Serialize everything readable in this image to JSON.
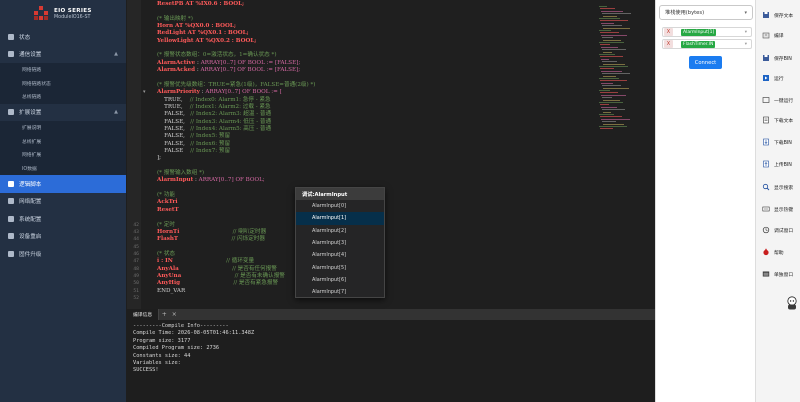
{
  "sidebar": {
    "brand_title": "EIO SERIES",
    "brand_subtitle": "ModuleIO16-ST",
    "items": [
      {
        "label": "状态",
        "type": "item",
        "icon": "status-icon"
      },
      {
        "label": "通信设置",
        "type": "item",
        "icon": "network-icon",
        "arrow": "▲"
      },
      {
        "label": "网络链路",
        "type": "sub"
      },
      {
        "label": "网络链路状态",
        "type": "sub"
      },
      {
        "label": "总线链路",
        "type": "sub"
      },
      {
        "label": "扩展设置",
        "type": "item",
        "icon": "expand-icon",
        "arrow": "▲"
      },
      {
        "label": "扩展说明",
        "type": "sub"
      },
      {
        "label": "总线扩展",
        "type": "sub"
      },
      {
        "label": "网络扩展",
        "type": "sub"
      },
      {
        "label": "IO数据",
        "type": "sub"
      },
      {
        "label": "逻辑脚本",
        "type": "item",
        "icon": "script-icon",
        "active": true
      },
      {
        "label": "网络配置",
        "type": "item",
        "icon": "globe-icon"
      },
      {
        "label": "系统配置",
        "type": "item",
        "icon": "gear-icon"
      },
      {
        "label": "设备重启",
        "type": "item",
        "icon": "restart-icon"
      },
      {
        "label": "固件升级",
        "type": "item",
        "icon": "upgrade-icon"
      }
    ]
  },
  "editor": {
    "lines": [
      {
        "n": "",
        "segs": [
          [
            "c-kw",
            "ResetPB AT %IX0.6 : BOOL;"
          ]
        ]
      },
      {
        "n": "",
        "segs": []
      },
      {
        "n": "",
        "segs": [
          [
            "c-com",
            "(* 输出映射 *)"
          ]
        ]
      },
      {
        "n": "",
        "segs": [
          [
            "c-kw",
            "Horn AT %QX0.0 : BOOL;"
          ]
        ]
      },
      {
        "n": "",
        "segs": [
          [
            "c-kw",
            "RedLight AT %QX0.1 : BOOL;"
          ]
        ]
      },
      {
        "n": "",
        "segs": [
          [
            "c-kw",
            "YellowLight AT %QX0.2 : BOOL;"
          ]
        ]
      },
      {
        "n": "",
        "segs": []
      },
      {
        "n": "",
        "segs": [
          [
            "c-com",
            "(* 报警状态数组：0=激活状态，1=确认状态 *)"
          ]
        ]
      },
      {
        "n": "",
        "segs": [
          [
            "c-kw",
            "AlarmActive"
          ],
          [
            "c-txt",
            " : "
          ],
          [
            "c-ty",
            "ARRAY[0..7] OF BOOL := [FALSE];"
          ]
        ]
      },
      {
        "n": "",
        "segs": [
          [
            "c-kw",
            "AlarmAcked"
          ],
          [
            "c-txt",
            " : "
          ],
          [
            "c-ty",
            "ARRAY[0..7] OF BOOL := [FALSE];"
          ]
        ]
      },
      {
        "n": "",
        "segs": []
      },
      {
        "n": "",
        "segs": [
          [
            "c-com",
            "(* 报警优先级数组：TRUE=紧急(1级)，FALSE=普通(2级) *)"
          ]
        ]
      },
      {
        "n": "",
        "segs": [
          [
            "c-kw",
            "AlarmPriority"
          ],
          [
            "c-txt",
            " : "
          ],
          [
            "c-ty",
            "ARRAY[0..7] OF BOOL := ["
          ]
        ]
      },
      {
        "n": "",
        "segs": [
          [
            "c-txt",
            "    TRUE,    "
          ],
          [
            "c-com",
            "// Index0: Alarm1: 急停 - 紧急"
          ]
        ]
      },
      {
        "n": "",
        "segs": [
          [
            "c-txt",
            "    TRUE,    "
          ],
          [
            "c-com",
            "// Index1: Alarm2: 过载 - 紧急"
          ]
        ]
      },
      {
        "n": "",
        "segs": [
          [
            "c-txt",
            "    FALSE,   "
          ],
          [
            "c-com",
            "// Index2: Alarm3: 超温 - 普通"
          ]
        ]
      },
      {
        "n": "",
        "segs": [
          [
            "c-txt",
            "    FALSE,   "
          ],
          [
            "c-com",
            "// Index3: Alarm4: 低压 - 普通"
          ]
        ]
      },
      {
        "n": "",
        "segs": [
          [
            "c-txt",
            "    FALSE,   "
          ],
          [
            "c-com",
            "// Index4: Alarm5: 高压 - 普通"
          ]
        ]
      },
      {
        "n": "",
        "segs": [
          [
            "c-txt",
            "    FALSE,   "
          ],
          [
            "c-com",
            "// Index5: 预留"
          ]
        ]
      },
      {
        "n": "",
        "segs": [
          [
            "c-txt",
            "    FALSE,   "
          ],
          [
            "c-com",
            "// Index6: 预留"
          ]
        ]
      },
      {
        "n": "",
        "segs": [
          [
            "c-txt",
            "    FALSE    "
          ],
          [
            "c-com",
            "// Index7: 预留"
          ]
        ]
      },
      {
        "n": "",
        "segs": [
          [
            "c-txt",
            "];"
          ]
        ]
      },
      {
        "n": "",
        "segs": []
      },
      {
        "n": "",
        "segs": [
          [
            "c-com",
            "(* 报警输入数组 *)"
          ]
        ]
      },
      {
        "n": "",
        "segs": [
          [
            "c-kw",
            "AlarmInput"
          ],
          [
            "c-txt",
            " : "
          ],
          [
            "c-ty",
            "ARRAY[0..7] OF BOOL;"
          ]
        ]
      },
      {
        "n": "",
        "segs": []
      },
      {
        "n": "",
        "segs": [
          [
            "c-com",
            "(* 功能"
          ]
        ]
      },
      {
        "n": "",
        "segs": [
          [
            "c-kw",
            "AckTri"
          ]
        ]
      },
      {
        "n": "",
        "segs": [
          [
            "c-kw",
            "ResetT"
          ]
        ]
      },
      {
        "n": "",
        "segs": []
      },
      {
        "n": "42",
        "segs": [
          [
            "c-com",
            "(* 定时"
          ]
        ]
      },
      {
        "n": "43",
        "segs": [
          [
            "c-kw",
            "HornTi"
          ],
          [
            "c-txt",
            "                              "
          ],
          [
            "c-com",
            "// 喇叭定时器"
          ]
        ]
      },
      {
        "n": "44",
        "segs": [
          [
            "c-kw",
            "FlashT"
          ],
          [
            "c-txt",
            "                              "
          ],
          [
            "c-com",
            "// 闪烁定时器"
          ]
        ]
      },
      {
        "n": "45",
        "segs": []
      },
      {
        "n": "46",
        "segs": [
          [
            "c-com",
            "(* 状态"
          ]
        ]
      },
      {
        "n": "47",
        "segs": [
          [
            "c-kw",
            "i : IN"
          ],
          [
            "c-txt",
            "                              "
          ],
          [
            "c-com",
            "// 循环变量"
          ]
        ]
      },
      {
        "n": "48",
        "segs": [
          [
            "c-kw",
            "AnyAla"
          ],
          [
            "c-txt",
            "                              "
          ],
          [
            "c-com",
            "// 是否有任何报警"
          ]
        ]
      },
      {
        "n": "49",
        "segs": [
          [
            "c-kw",
            "AnyUna"
          ],
          [
            "c-txt",
            "                              "
          ],
          [
            "c-com",
            "// 是否有未确认报警"
          ]
        ]
      },
      {
        "n": "50",
        "segs": [
          [
            "c-kw",
            "AnyHig"
          ],
          [
            "c-txt",
            "                              "
          ],
          [
            "c-com",
            "// 是否有紧急报警"
          ]
        ]
      },
      {
        "n": "51",
        "segs": [
          [
            "c-txt",
            "END_VAR"
          ]
        ]
      },
      {
        "n": "52",
        "segs": []
      }
    ]
  },
  "autocomplete": {
    "header": "调试:AlarmInput",
    "items": [
      "AlarmInput[0]",
      "AlarmInput[1]",
      "AlarmInput[2]",
      "AlarmInput[3]",
      "AlarmInput[4]",
      "AlarmInput[5]",
      "AlarmInput[6]",
      "AlarmInput[7]"
    ],
    "selected_index": 1
  },
  "compile": {
    "tab_label": "编译信息",
    "tab_add": "+",
    "tab_close": "×",
    "output": [
      "---------Compile Info---------",
      "Compile Time: 2026-08-05T01:46:11.348Z",
      "Program size: 3177",
      "Compiled Program size: 2736",
      "Constants size: 44",
      "Variables size:",
      "SUCCESS!"
    ]
  },
  "varpanel": {
    "select_value": "堆栈使用(bytes)",
    "rows": [
      {
        "x": "X",
        "tag": "AlarmInput[1]"
      },
      {
        "x": "X",
        "tag": "FlashTimer.IN"
      }
    ],
    "connect_label": "Connect"
  },
  "tools": [
    {
      "label": "保存文本",
      "icon": "save-text-icon"
    },
    {
      "label": "编译",
      "icon": "compile-icon"
    },
    {
      "label": "保存BIN",
      "icon": "save-bin-icon"
    },
    {
      "label": "运行",
      "icon": "run-icon"
    },
    {
      "label": "一键运行",
      "icon": "one-click-run-icon"
    },
    {
      "label": "下载文本",
      "icon": "download-text-icon"
    },
    {
      "label": "下载BIN",
      "icon": "download-bin-icon"
    },
    {
      "label": "上传BIN",
      "icon": "upload-bin-icon"
    },
    {
      "label": "显示搜索",
      "icon": "search-icon"
    },
    {
      "label": "显示热键",
      "icon": "keyboard-icon"
    },
    {
      "label": "调试窗口",
      "icon": "debug-window-icon"
    },
    {
      "label": "帮助",
      "icon": "help-icon"
    },
    {
      "label": "单独窗口",
      "icon": "window-icon"
    }
  ],
  "colors": {
    "sidebar_bg": "#233043",
    "sidebar_active": "#2c6cd8",
    "editor_bg": "#1f1f1f",
    "keyword": "#ff5a5a",
    "comment": "#6a9955",
    "connect_button": "#1b7cf0",
    "tag_green": "#27a844"
  }
}
